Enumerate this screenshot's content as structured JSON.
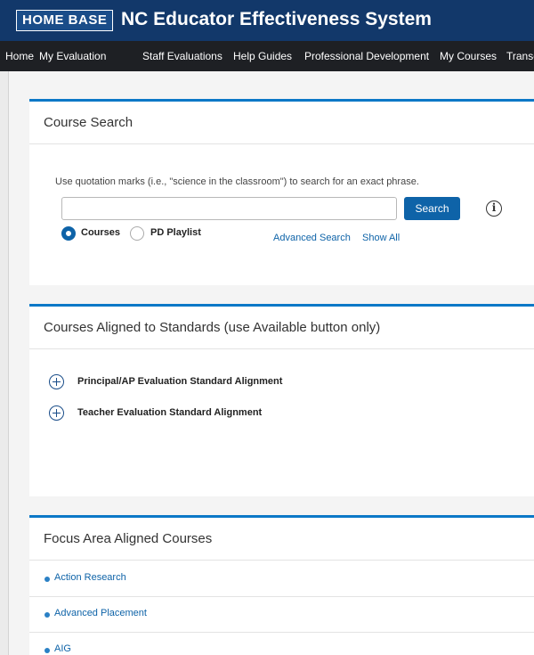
{
  "header": {
    "logo": "HOME BASE",
    "title": "NC Educator Effectiveness System"
  },
  "nav": {
    "items": [
      "Home",
      "My Evaluation",
      "Staff Evaluations",
      "Help Guides",
      "Professional Development",
      "My Courses",
      "Transcript"
    ]
  },
  "course_search": {
    "title": "Course Search",
    "hint": "Use quotation marks (i.e., \"science in the classroom\") to search for an exact phrase.",
    "input_value": "",
    "search_button": "Search",
    "info_icon": "i",
    "options": [
      {
        "label": "Courses",
        "selected": true
      },
      {
        "label": "PD Playlist",
        "selected": false
      }
    ],
    "advanced_link": "Advanced Search",
    "show_all_link": "Show All"
  },
  "standards": {
    "title": "Courses Aligned to Standards (use Available button only)",
    "items": [
      "Principal/AP Evaluation Standard Alignment",
      "Teacher Evaluation Standard Alignment"
    ]
  },
  "focus": {
    "title": "Focus Area Aligned Courses",
    "items": [
      "Action Research",
      "Advanced Placement",
      "AIG"
    ]
  },
  "colors": {
    "header_bg": "#12386a",
    "nav_bg": "#1e2024",
    "accent": "#0b78c7",
    "button": "#0e63a8"
  }
}
